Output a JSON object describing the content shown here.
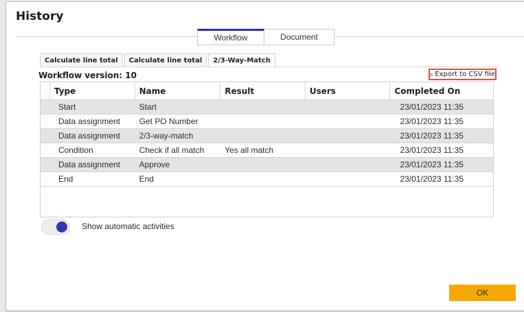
{
  "dialog": {
    "title": "History"
  },
  "top_tabs": [
    {
      "label": "Workflow",
      "active": true
    },
    {
      "label": "Document",
      "active": false
    }
  ],
  "sub_tabs": [
    {
      "label": "Calculate line total",
      "active": false
    },
    {
      "label": "Calculate line total",
      "active": false
    },
    {
      "label": "2/3-Way-Match",
      "active": true
    }
  ],
  "workflow_version": "Workflow version: 10",
  "export": {
    "label": "Export to CSV file",
    "icon": "export-icon"
  },
  "grid": {
    "columns": [
      "Type",
      "Name",
      "Result",
      "Users",
      "Completed On"
    ],
    "rows": [
      {
        "type": "Start",
        "name": "Start",
        "result": "",
        "users": "",
        "completed": "23/01/2023 11:35"
      },
      {
        "type": "Data assignment",
        "name": "Get PO Number",
        "result": "",
        "users": "",
        "completed": "23/01/2023 11:35"
      },
      {
        "type": "Data assignment",
        "name": "2/3-way-match",
        "result": "",
        "users": "",
        "completed": "23/01/2023 11:35"
      },
      {
        "type": "Condition",
        "name": "Check if all match",
        "result": "Yes all match",
        "users": "",
        "completed": "23/01/2023 11:35"
      },
      {
        "type": "Data assignment",
        "name": "Approve",
        "result": "",
        "users": "",
        "completed": "23/01/2023 11:35"
      },
      {
        "type": "End",
        "name": "End",
        "result": "",
        "users": "",
        "completed": "23/01/2023 11:35"
      }
    ]
  },
  "toggle": {
    "label": "Show automatic activities",
    "on": true
  },
  "footer": {
    "ok_label": "OK"
  },
  "colors": {
    "accent_tab": "#2b2f9e",
    "ok_button": "#f5a800",
    "export_border": "#e84c3d",
    "toggle_knob": "#3333bb"
  }
}
